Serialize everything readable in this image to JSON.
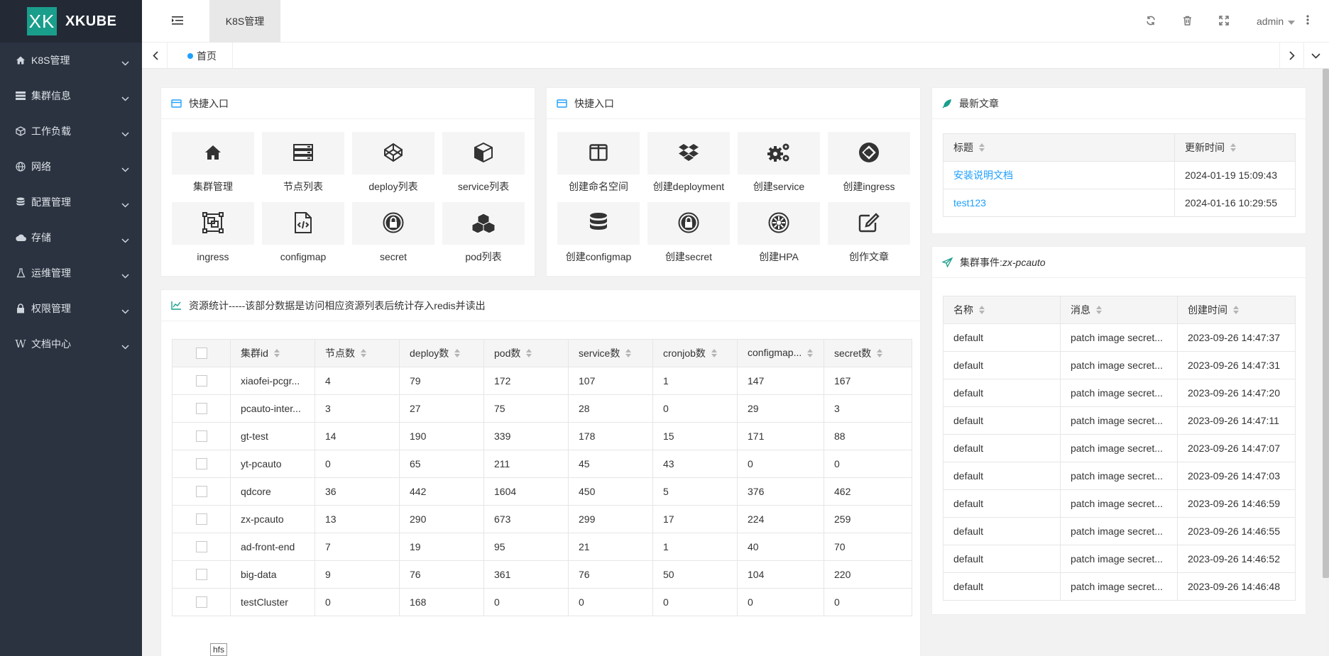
{
  "brand": {
    "logo_mark": "XK",
    "name": "XKUBE"
  },
  "sidebar": {
    "items": [
      {
        "label": "K8S管理",
        "icon": "home-icon"
      },
      {
        "label": "集群信息",
        "icon": "server-list-icon"
      },
      {
        "label": "工作负载",
        "icon": "cube-icon"
      },
      {
        "label": "网络",
        "icon": "globe-icon"
      },
      {
        "label": "配置管理",
        "icon": "database-icon"
      },
      {
        "label": "存储",
        "icon": "cloud-icon"
      },
      {
        "label": "运维管理",
        "icon": "flask-icon"
      },
      {
        "label": "权限管理",
        "icon": "lock-icon"
      },
      {
        "label": "文档中心",
        "icon": "w-icon"
      }
    ]
  },
  "topbar": {
    "tab_label": "K8S管理",
    "user": "admin",
    "icons": [
      "refresh-icon",
      "trash-icon",
      "fullscreen-icon",
      "more-vertical-icon"
    ]
  },
  "tabs": {
    "home": "首页"
  },
  "quick1": {
    "title": "快捷入口",
    "items": [
      {
        "label": "集群管理",
        "icon": "home-icon"
      },
      {
        "label": "节点列表",
        "icon": "server-list-icon"
      },
      {
        "label": "deploy列表",
        "icon": "codepen-icon"
      },
      {
        "label": "service列表",
        "icon": "cube-icon"
      },
      {
        "label": "ingress",
        "icon": "object-group-icon"
      },
      {
        "label": "configmap",
        "icon": "file-code-icon"
      },
      {
        "label": "secret",
        "icon": "lock-circle-icon"
      },
      {
        "label": "pod列表",
        "icon": "cubes-icon"
      }
    ]
  },
  "quick2": {
    "title": "快捷入口",
    "items": [
      {
        "label": "创建命名空间",
        "icon": "columns-icon"
      },
      {
        "label": "创建deployment",
        "icon": "dropbox-icon"
      },
      {
        "label": "创建service",
        "icon": "gears-icon"
      },
      {
        "label": "创建ingress",
        "icon": "ingress-circle-icon"
      },
      {
        "label": "创建configmap",
        "icon": "database-icon"
      },
      {
        "label": "创建secret",
        "icon": "lock-circle-icon"
      },
      {
        "label": "创建HPA",
        "icon": "empire-icon"
      },
      {
        "label": "创作文章",
        "icon": "edit-icon"
      }
    ]
  },
  "articles": {
    "title": "最新文章",
    "headers": [
      "标题",
      "更新时间"
    ],
    "rows": [
      [
        "安装说明文档",
        "2024-01-19 15:09:43"
      ],
      [
        "test123",
        "2024-01-16 10:29:55"
      ]
    ]
  },
  "events": {
    "title_prefix": "集群事件:",
    "cluster": "zx-pcauto",
    "headers": [
      "名称",
      "消息",
      "创建时间"
    ],
    "rows": [
      [
        "default",
        "patch image secret...",
        "2023-09-26 14:47:37"
      ],
      [
        "default",
        "patch image secret...",
        "2023-09-26 14:47:31"
      ],
      [
        "default",
        "patch image secret...",
        "2023-09-26 14:47:20"
      ],
      [
        "default",
        "patch image secret...",
        "2023-09-26 14:47:11"
      ],
      [
        "default",
        "patch image secret...",
        "2023-09-26 14:47:07"
      ],
      [
        "default",
        "patch image secret...",
        "2023-09-26 14:47:03"
      ],
      [
        "default",
        "patch image secret...",
        "2023-09-26 14:46:59"
      ],
      [
        "default",
        "patch image secret...",
        "2023-09-26 14:46:55"
      ],
      [
        "default",
        "patch image secret...",
        "2023-09-26 14:46:52"
      ],
      [
        "default",
        "patch image secret...",
        "2023-09-26 14:46:48"
      ]
    ]
  },
  "stats": {
    "title": "资源统计-----该部分数据是访问相应资源列表后统计存入redis并读出",
    "headers": [
      "集群id",
      "节点数",
      "deploy数",
      "pod数",
      "service数",
      "cronjob数",
      "configmap...",
      "secret数"
    ],
    "rows": [
      [
        "xiaofei-pcgr...",
        "4",
        "79",
        "172",
        "107",
        "1",
        "147",
        "167"
      ],
      [
        "pcauto-inter...",
        "3",
        "27",
        "75",
        "28",
        "0",
        "29",
        "3"
      ],
      [
        "gt-test",
        "14",
        "190",
        "339",
        "178",
        "15",
        "171",
        "88"
      ],
      [
        "yt-pcauto",
        "0",
        "65",
        "211",
        "45",
        "43",
        "0",
        "0"
      ],
      [
        "qdcore",
        "36",
        "442",
        "1604",
        "450",
        "5",
        "376",
        "462"
      ],
      [
        "zx-pcauto",
        "13",
        "290",
        "673",
        "299",
        "17",
        "224",
        "259"
      ],
      [
        "ad-front-end",
        "7",
        "19",
        "95",
        "21",
        "1",
        "40",
        "70"
      ],
      [
        "big-data",
        "9",
        "76",
        "361",
        "76",
        "50",
        "104",
        "220"
      ],
      [
        "testCluster",
        "0",
        "168",
        "0",
        "0",
        "0",
        "0",
        "0"
      ]
    ]
  },
  "tooltip": "hfs",
  "colors": {
    "sidebar_bg": "#2b3341",
    "accent": "#1e9fff",
    "logo": "#1a9e8c"
  }
}
